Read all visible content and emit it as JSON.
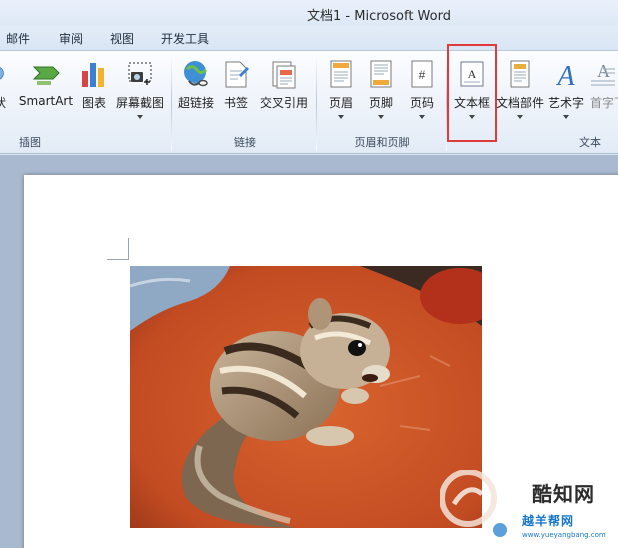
{
  "window": {
    "title": "文档1 - Microsoft Word"
  },
  "menu_tabs": [
    {
      "label": "邮件"
    },
    {
      "label": "审阅"
    },
    {
      "label": "视图"
    },
    {
      "label": "开发工具"
    }
  ],
  "ribbon": {
    "illustrations": {
      "group_label": "插图",
      "shapes_partial_label": "状",
      "smartart_label": "SmartArt",
      "chart_label": "图表",
      "screenshot_label": "屏幕截图"
    },
    "links": {
      "group_label": "链接",
      "hyperlink_label": "超链接",
      "bookmark_label": "书签",
      "crossref_label": "交叉引用"
    },
    "header_footer": {
      "group_label": "页眉和页脚",
      "header_label": "页眉",
      "footer_label": "页脚",
      "pagenum_label": "页码"
    },
    "text": {
      "group_label": "文本",
      "textbox_label": "文本框",
      "quickparts_label": "文档部件",
      "wordart_label": "艺术字",
      "dropcap_partial_label": "首字下"
    }
  },
  "watermark": {
    "brand": "酷知网",
    "site_name": "越羊帮网",
    "site_url": "www.yueyangbang.com"
  },
  "colors": {
    "highlight_border": "#e03a3a",
    "ribbon_bg": "#eef3fa",
    "workspace_bg": "#a9b9cf"
  }
}
